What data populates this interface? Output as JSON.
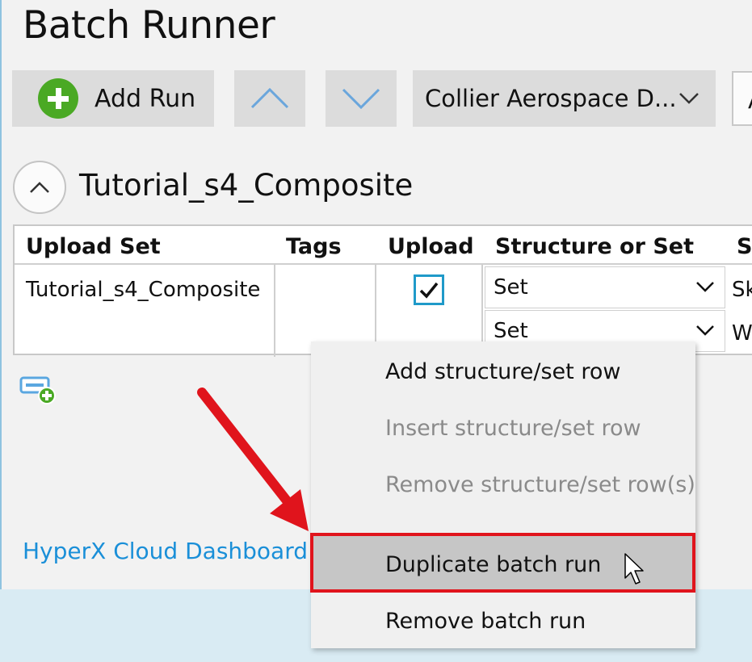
{
  "window": {
    "title": "Batch Runner"
  },
  "toolbar": {
    "add_run_label": "Add Run",
    "configuration_selected": "Collier Aerospace D...",
    "partial_control_text": "A"
  },
  "run": {
    "name": "Tutorial_s4_Composite",
    "columns": [
      "Upload Set",
      "Tags",
      "Upload",
      "Structure or Set",
      "St"
    ],
    "row": {
      "upload_set": "Tutorial_s4_Composite",
      "tags": "",
      "upload_checked": true,
      "structure_rows": [
        {
          "type": "Set",
          "next_col": "Sk"
        },
        {
          "type": "Set",
          "next_col": "W"
        }
      ]
    }
  },
  "links": {
    "dashboard": "HyperX Cloud Dashboard"
  },
  "context_menu": {
    "items": [
      {
        "label": "Add structure/set row",
        "enabled": true
      },
      {
        "label": "Insert structure/set row",
        "enabled": false
      },
      {
        "label": "Remove structure/set row(s)",
        "enabled": false
      },
      {
        "label": "Duplicate batch run",
        "enabled": true,
        "highlighted": true
      },
      {
        "label": "Remove batch run",
        "enabled": true
      }
    ]
  },
  "colors": {
    "accent_link": "#1a8fd8",
    "annotation_red": "#e0141c",
    "add_green": "#4aa924",
    "checkbox_border": "#1f9ac9"
  }
}
